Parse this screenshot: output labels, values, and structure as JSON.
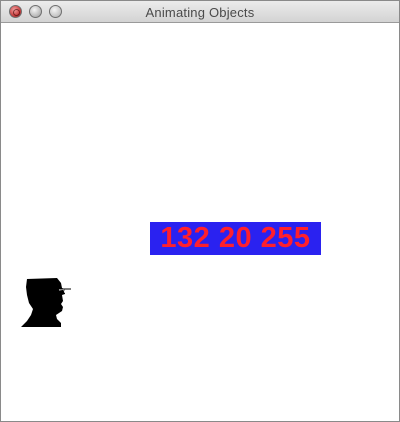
{
  "window": {
    "title": "Animating Objects"
  },
  "titlebar": {
    "buttons": {
      "close_icon": "close-circle",
      "minimize_icon": "minimize-circle",
      "zoom_icon": "zoom-circle"
    }
  },
  "canvas": {
    "color_label": {
      "text": "132 20 255",
      "text_color": "#ff1f2d",
      "background_color": "#2a22f0"
    },
    "head_image": {
      "icon": "head-silhouette-icon"
    }
  }
}
